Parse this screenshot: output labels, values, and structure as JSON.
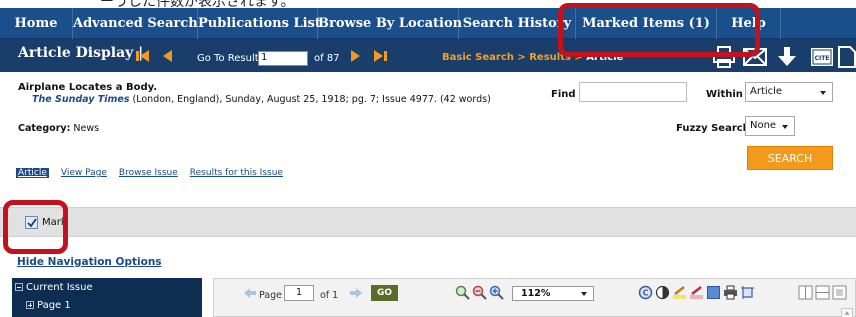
{
  "caption": "ーうした件数が表示されます。",
  "nav": {
    "items": [
      {
        "label": "Home"
      },
      {
        "label": "Advanced Search"
      },
      {
        "label": "Publications List"
      },
      {
        "label": "Browse By Location"
      },
      {
        "label": "Search History"
      },
      {
        "label": "Marked Items  (1)"
      },
      {
        "label": "Help"
      }
    ]
  },
  "display_bar": {
    "title": "Article Display |",
    "goto_label": "Go To Result",
    "goto_value": "1",
    "of_label": "of 87",
    "breadcrumb": {
      "part1": "Basic Search",
      "sep1": " > ",
      "part2": "Results",
      "sep2": " > ",
      "current": "Article"
    },
    "tools": [
      "print-icon",
      "email-icon",
      "download-icon",
      "cite-icon",
      "page-icon"
    ],
    "cite_text": "CITE"
  },
  "article": {
    "title": "Airplane Locates a Body.",
    "source": "The Sunday Times",
    "citation_rest": " (London, England), Sunday, August 25, 1918; pg. 7; Issue 4977.  (42 words)",
    "category_label": "Category:",
    "category_value": " News"
  },
  "search": {
    "find_label": "Find",
    "find_value": "",
    "within_label": "Within",
    "within_value": "Article",
    "fuzzy_label": "Fuzzy Search",
    "fuzzy_value": "None",
    "button": "SEARCH"
  },
  "tabs": [
    {
      "label": "Article",
      "active": true
    },
    {
      "label": "View Page",
      "active": false
    },
    {
      "label": "Browse Issue",
      "active": false
    },
    {
      "label": "Results for this Issue",
      "active": false
    }
  ],
  "mark": {
    "label": "Mark",
    "checked": true
  },
  "hide_nav": "Hide Navigation Options",
  "tree": {
    "items": [
      {
        "label": "Current Issue",
        "expanded": true
      },
      {
        "label": "Page 1",
        "expanded": false
      }
    ]
  },
  "viewer": {
    "page_label": "Page",
    "page_value": "1",
    "of_label": "of 1",
    "go_label": "GO",
    "zoom_value": "112%"
  },
  "colors": {
    "nav_bg": "#1b4f8c",
    "display_bar_bg": "#1a3e6c",
    "accent_orange": "#f39a1d",
    "link_blue": "#1a4a8a",
    "annotation_red": "#c3121b"
  }
}
